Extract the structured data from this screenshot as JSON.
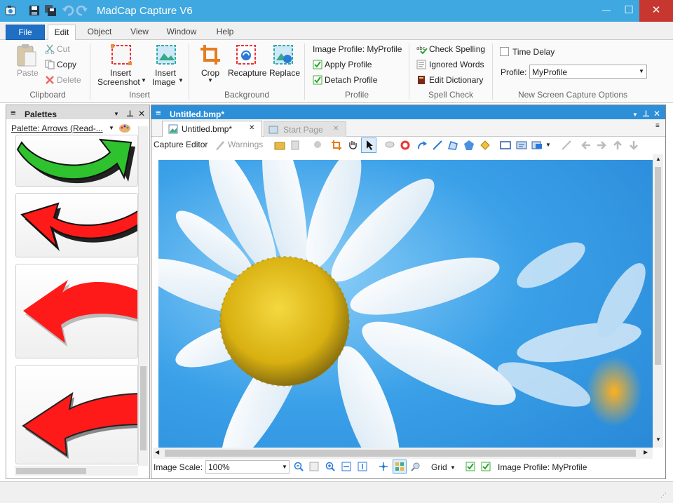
{
  "window": {
    "title": "MadCap Capture V6",
    "minimize": "—",
    "maximize": "☐",
    "close": "✕"
  },
  "ribbon_tabs": [
    "File",
    "Edit",
    "Object",
    "View",
    "Window",
    "Help"
  ],
  "clipboard": {
    "paste": "Paste",
    "cut": "Cut",
    "copy": "Copy",
    "delete": "Delete",
    "group": "Clipboard"
  },
  "insert": {
    "screenshot_l1": "Insert",
    "screenshot_l2": "Screenshot",
    "image_l1": "Insert",
    "image_l2": "Image",
    "group": "Insert"
  },
  "background": {
    "crop": "Crop",
    "recapture": "Recapture",
    "replace": "Replace",
    "group": "Background"
  },
  "profile": {
    "image_profile": "Image Profile: MyProfile",
    "apply": "Apply Profile",
    "detach": "Detach Profile",
    "group": "Profile"
  },
  "spell": {
    "check": "Check Spelling",
    "ignored": "Ignored Words",
    "edit_dict": "Edit Dictionary",
    "group": "Spell Check"
  },
  "capture_options": {
    "time_delay": "Time Delay",
    "profile_label": "Profile:",
    "profile_value": "MyProfile",
    "group": "New Screen Capture Options"
  },
  "palettes": {
    "header": "Palettes",
    "palette_select": "Palette: Arrows (Read-..."
  },
  "document": {
    "header": "Untitled.bmp*",
    "tab_active": "Untitled.bmp*",
    "tab_other": "Start Page"
  },
  "editor_toolbar": {
    "capture_editor": "Capture Editor",
    "warnings": "Warnings"
  },
  "bottom_bar": {
    "image_scale_label": "Image Scale:",
    "image_scale_value": "100%",
    "grid": "Grid",
    "image_profile": "Image Profile: MyProfile"
  },
  "colors": {
    "titlebar": "#40a8e0",
    "file_tab": "#1f6fc5",
    "doc_header": "#2c8fd8",
    "sky": "#3aa0e8",
    "arrow_green": "#2ec22e",
    "arrow_red": "#ff1a1a",
    "flower_center": "#e8c020"
  }
}
